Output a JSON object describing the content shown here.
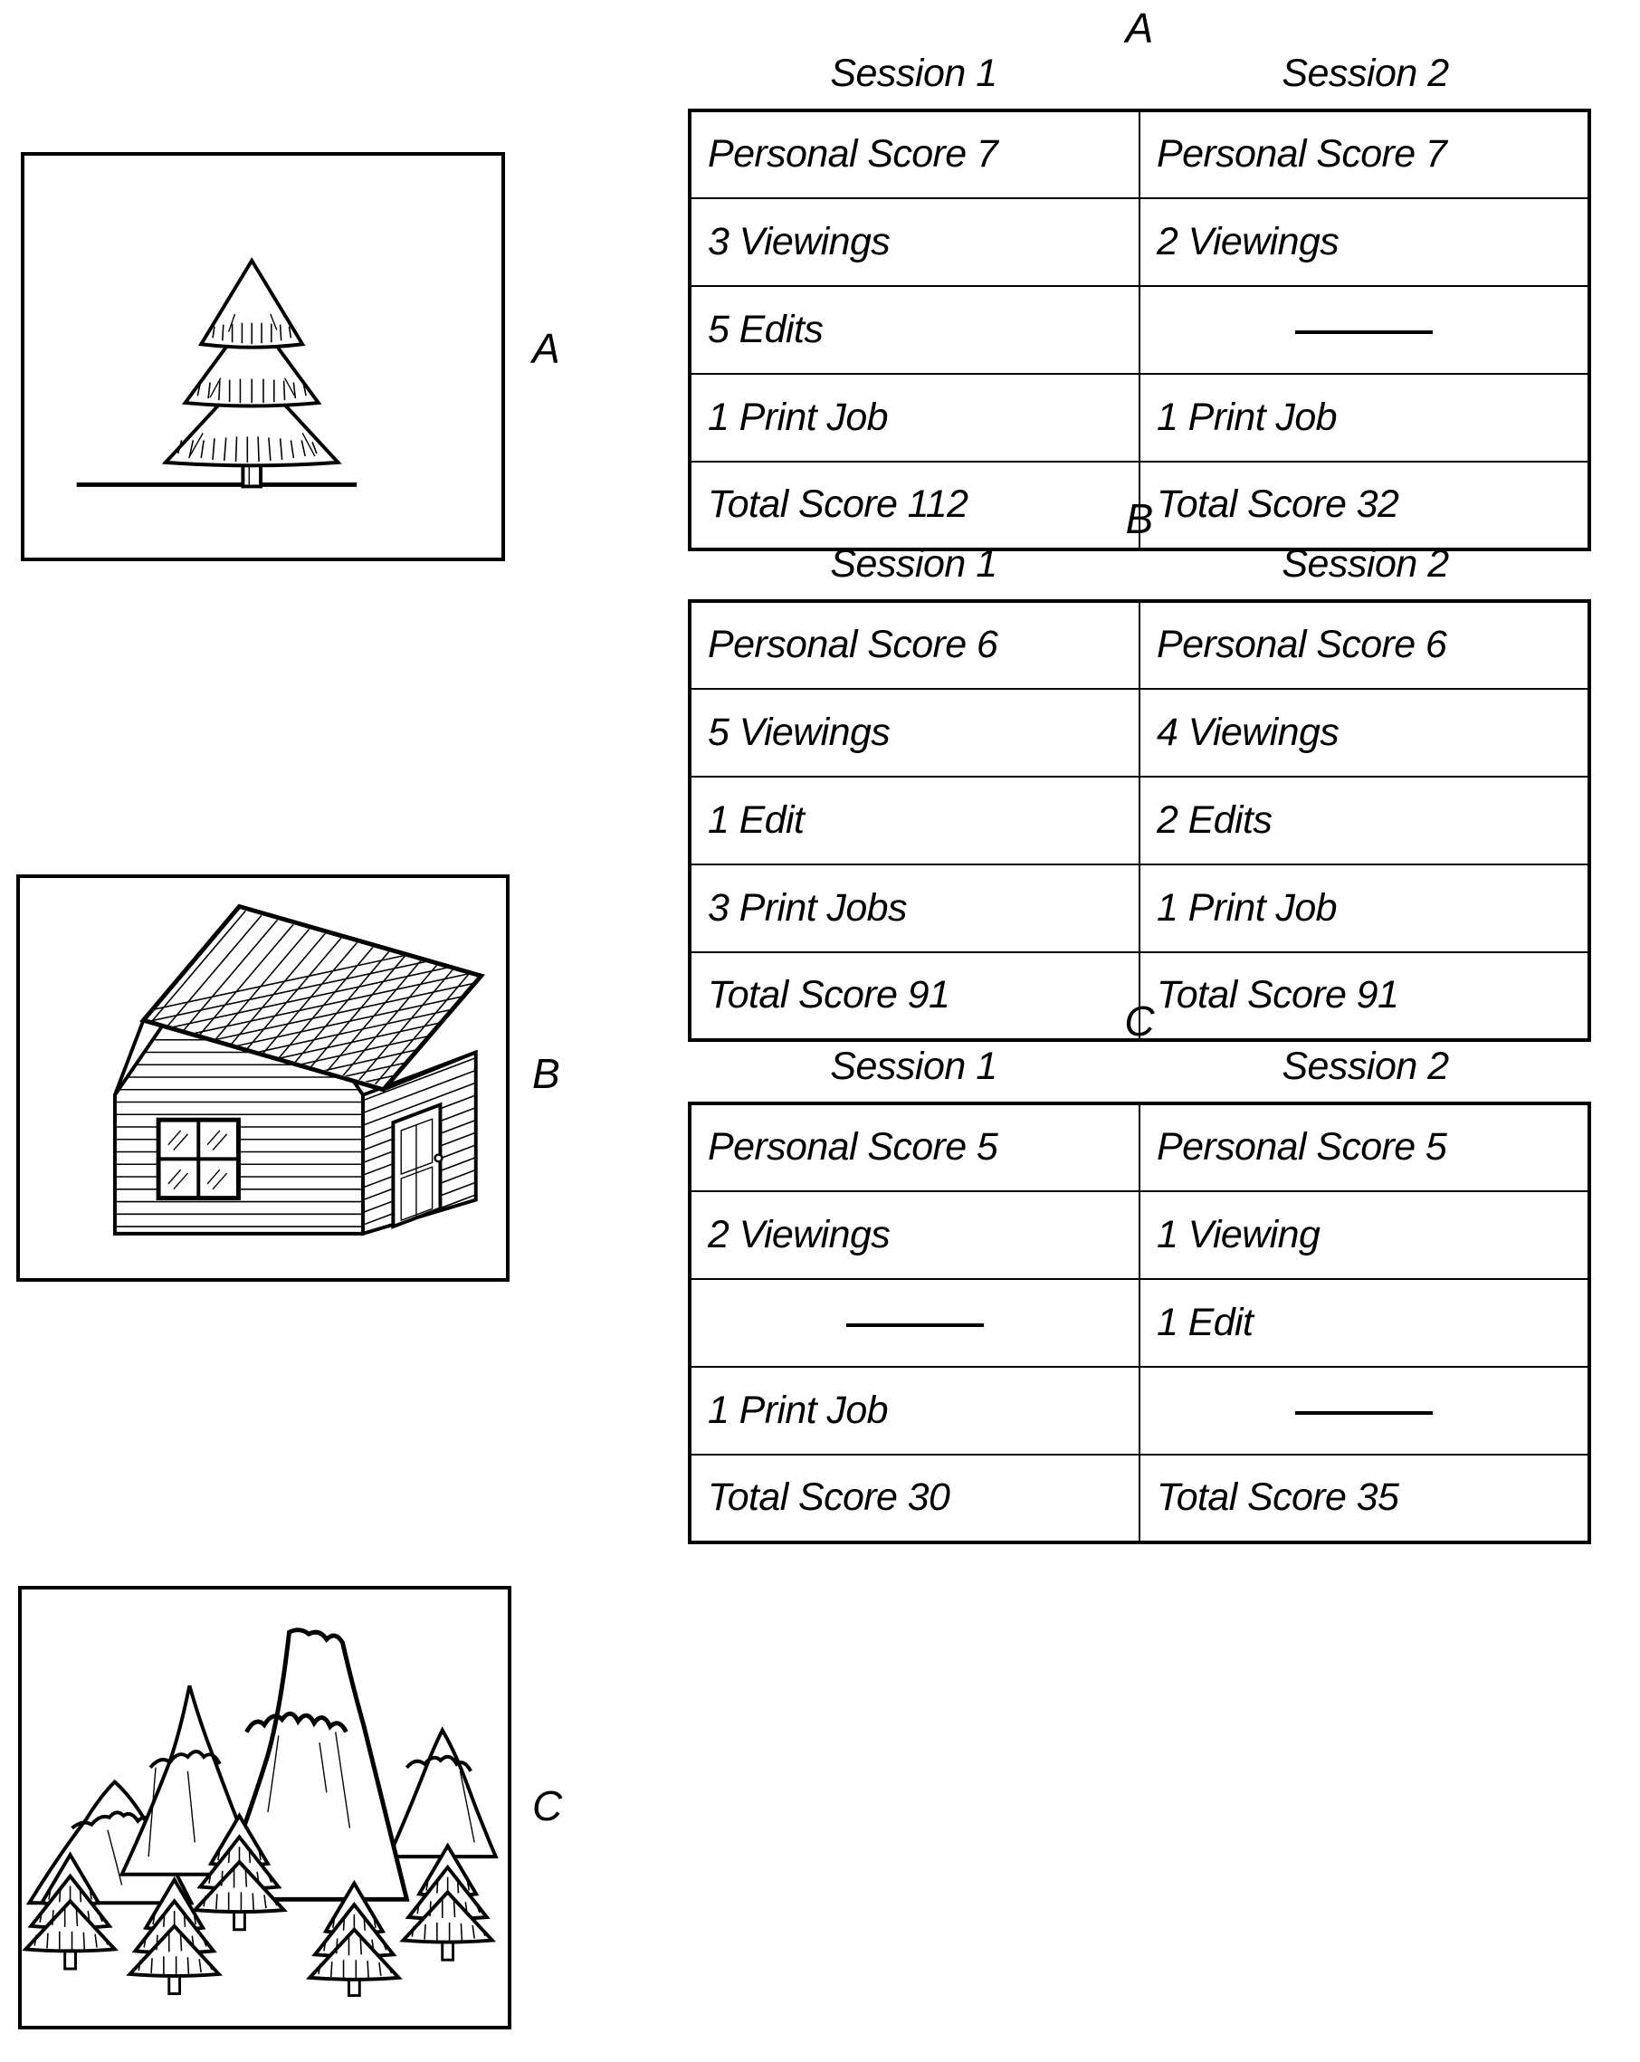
{
  "figure": {
    "sections": [
      {
        "id": "A",
        "image_label": "A",
        "image_name": "tree-drawing",
        "table_title": "A",
        "columns": [
          "Session 1",
          "Session 2"
        ],
        "rows": [
          [
            "Personal Score 7",
            "Personal Score 7"
          ],
          [
            "3 Viewings",
            "2 Viewings"
          ],
          [
            "5 Edits",
            "—"
          ],
          [
            "1 Print Job",
            "1 Print Job"
          ],
          [
            "Total Score 112",
            "Total Score 32"
          ]
        ]
      },
      {
        "id": "B",
        "image_label": "B",
        "image_name": "house-drawing",
        "table_title": "B",
        "columns": [
          "Session 1",
          "Session 2"
        ],
        "rows": [
          [
            "Personal Score 6",
            "Personal Score 6"
          ],
          [
            "5 Viewings",
            "4 Viewings"
          ],
          [
            "1 Edit",
            "2 Edits"
          ],
          [
            "3 Print Jobs",
            "1 Print Job"
          ],
          [
            "Total Score 91",
            "Total Score 91"
          ]
        ]
      },
      {
        "id": "C",
        "image_label": "C",
        "image_name": "mountain-scene-drawing",
        "table_title": "C",
        "columns": [
          "Session 1",
          "Session 2"
        ],
        "rows": [
          [
            "2 Viewings",
            "1 Viewing"
          ],
          [
            "Personal Score 5",
            "Personal Score 5"
          ],
          [
            "—",
            "1 Edit"
          ],
          [
            "1 Print Job",
            "—"
          ],
          [
            "Total Score 30",
            "Total Score 35"
          ]
        ]
      }
    ]
  },
  "tables": {
    "A": {
      "title": "A",
      "col1": "Session 1",
      "col2": "Session 2",
      "r0c0": "Personal Score 7",
      "r0c1": "Personal Score 7",
      "r1c0": "3 Viewings",
      "r1c1": "2 Viewings",
      "r2c0": "5 Edits",
      "r2c1": "—",
      "r3c0": "1 Print Job",
      "r3c1": "1 Print Job",
      "r4c0": "Total Score 112",
      "r4c1": "Total Score 32"
    },
    "B": {
      "title": "B",
      "col1": "Session 1",
      "col2": "Session 2",
      "r0c0": "Personal Score 6",
      "r0c1": "Personal Score 6",
      "r1c0": "5 Viewings",
      "r1c1": "4 Viewings",
      "r2c0": "1 Edit",
      "r2c1": "2 Edits",
      "r3c0": "3 Print Jobs",
      "r3c1": "1 Print Job",
      "r4c0": "Total Score 91",
      "r4c1": "Total Score 91"
    },
    "C": {
      "title": "C",
      "col1": "Session 1",
      "col2": "Session 2",
      "r0c0": "Personal Score 5",
      "r0c1": "Personal Score 5",
      "r1c0": "2 Viewings",
      "r1c1": "1 Viewing",
      "r2c0": "—",
      "r2c1": "1 Edit",
      "r3c0": "1 Print Job",
      "r3c1": "—",
      "r4c0": "Total Score 30",
      "r4c1": "Total Score 35"
    }
  },
  "image_labels": {
    "A": "A",
    "B": "B",
    "C": "C"
  },
  "colors": {
    "ink": "#000000",
    "paper": "#ffffff"
  }
}
